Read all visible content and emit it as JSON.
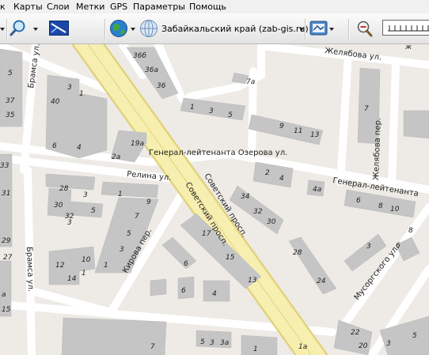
{
  "menu": {
    "items": [
      "к",
      "Карты",
      "Слои",
      "Метки",
      "GPS",
      "Параметры",
      "Помощь"
    ]
  },
  "toolbar": {
    "region": "Забайкальский край (zab-gis.ru)",
    "icons": [
      "search-icon",
      "map-view-icon",
      "globe-icon",
      "web-source-icon",
      "layers-icon",
      "zoom-out-icon",
      "scale-bar-icon"
    ]
  },
  "colors": {
    "background": "#eeebe6",
    "building": "#c5c5c5",
    "road": "#ffffff",
    "main_road": "#f6efb0",
    "main_road_edge": "#e1d27d"
  },
  "map": {
    "streets": {
      "zhelyabova_top": "Желябова ул.",
      "bramsa_top": "Брамса ул.",
      "bramsa_left": "Брамса ул.",
      "ozerova": "Генерал-лейтенанта Озерова ул.",
      "general_right": "Генерал-лейтенанта",
      "relina": "Релина ул.",
      "sovetsky1": "Советский просп.",
      "sovetsky2": "Советский просп.",
      "zhelyabova_per": "Желябова пер.",
      "kirova_per": "Кирова пер.",
      "musorgskogo": "Мусоргского ул."
    },
    "house_numbers": [
      "5",
      "37",
      "35",
      "3",
      "1",
      "40",
      "6",
      "4",
      "2a",
      "36б",
      "36a",
      "36",
      "7a",
      "1",
      "3",
      "5",
      "9",
      "11",
      "13",
      "7",
      "ж",
      "2",
      "4",
      "4a",
      "6",
      "8",
      "10",
      "34",
      "32",
      "30",
      "28",
      "24",
      "19a",
      "28",
      "30",
      "32",
      "3",
      "5",
      "1",
      "9",
      "7",
      "5",
      "3",
      "1",
      "17",
      "15",
      "13",
      "6",
      "6",
      "4",
      "12",
      "14",
      "10",
      "3",
      "1",
      "33",
      "31",
      "29",
      "27",
      "а",
      "15",
      "3",
      "6",
      "8",
      "22",
      "20",
      "3",
      "5",
      "7",
      "5",
      "3",
      "3a",
      "1",
      "1a"
    ]
  }
}
